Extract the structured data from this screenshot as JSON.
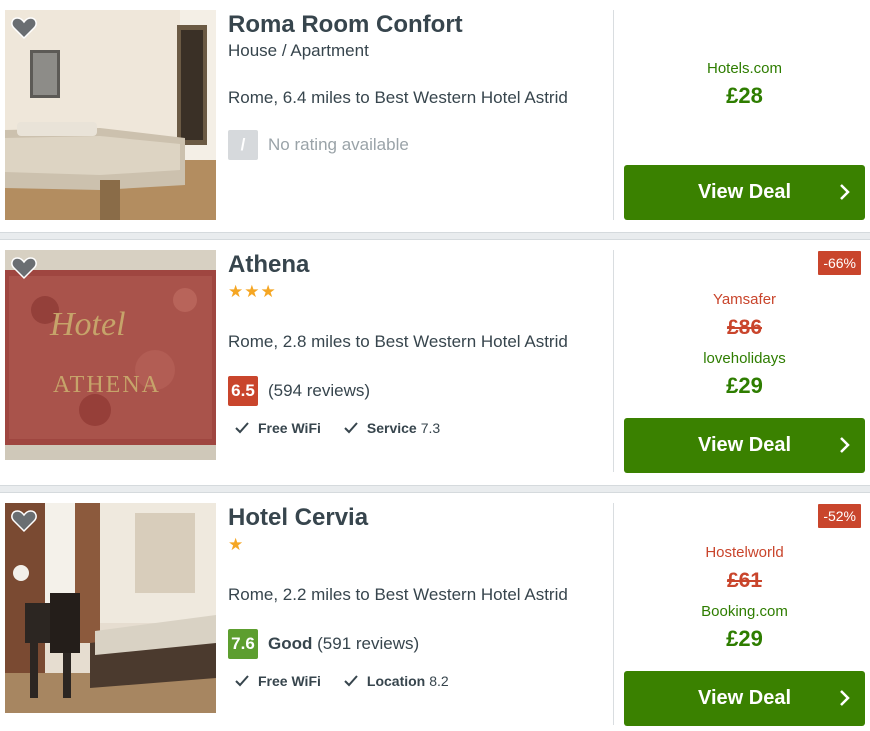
{
  "colors": {
    "price_green": "#2e7d00",
    "button_green": "#3a8100",
    "discount_red": "#c9452c",
    "score_red": "#c9452c",
    "score_green": "#5d9e2f",
    "score_none": "#d6d9dc",
    "star": "#f5a623"
  },
  "hotels": [
    {
      "name": "Roma Room Confort",
      "type": "House / Apartment",
      "location": "Rome, 6.4 miles to Best Western Hotel Astrid",
      "score": "/",
      "rating_text": "No rating available",
      "provider": "Hotels.com",
      "price": "£28",
      "button": "View Deal",
      "icons": [
        "heart-icon",
        "chevron-right-icon"
      ]
    },
    {
      "name": "Athena",
      "stars": "★★★",
      "star_count": 3,
      "location": "Rome, 2.8 miles to Best Western Hotel Astrid",
      "score": "6.5",
      "reviews": "(594 reviews)",
      "amenities": [
        {
          "label": "Free WiFi",
          "value": ""
        },
        {
          "label": "Service",
          "value": "7.3"
        }
      ],
      "discount": "-66%",
      "old_provider": "Yamsafer",
      "old_price": "£86",
      "provider": "loveholidays",
      "price": "£29",
      "button": "View Deal",
      "icons": [
        "heart-icon",
        "check-icon",
        "chevron-right-icon"
      ]
    },
    {
      "name": "Hotel Cervia",
      "stars": "★",
      "star_count": 1,
      "location": "Rome, 2.2 miles to Best Western Hotel Astrid",
      "score": "7.6",
      "rating_word": "Good",
      "reviews": "(591 reviews)",
      "amenities": [
        {
          "label": "Free WiFi",
          "value": ""
        },
        {
          "label": "Location",
          "value": "8.2"
        }
      ],
      "discount": "-52%",
      "old_provider": "Hostelworld",
      "old_price": "£61",
      "provider": "Booking.com",
      "price": "£29",
      "button": "View Deal",
      "icons": [
        "heart-icon",
        "check-icon",
        "chevron-right-icon"
      ]
    }
  ]
}
